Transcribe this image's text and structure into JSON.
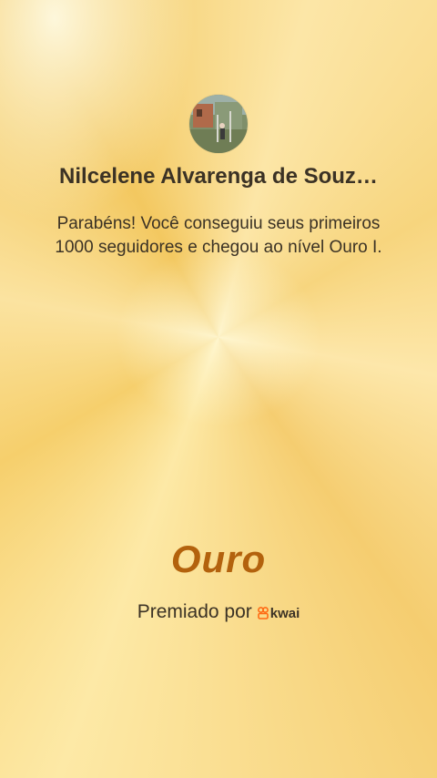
{
  "profile": {
    "name": "Nilcelene Alvarenga de Souz…",
    "avatar_icon": "profile-photo-icon"
  },
  "message": "Parabéns! Você conseguiu seus primeiros 1000 seguidores e chegou ao nível Ouro I.",
  "level": {
    "title": "Ouro",
    "color": "#b3620d"
  },
  "awarded": {
    "label": "Premiado por",
    "brand": "kwai",
    "brand_color": "#ff6a13",
    "brand_icon": "kwai-logo-icon"
  }
}
